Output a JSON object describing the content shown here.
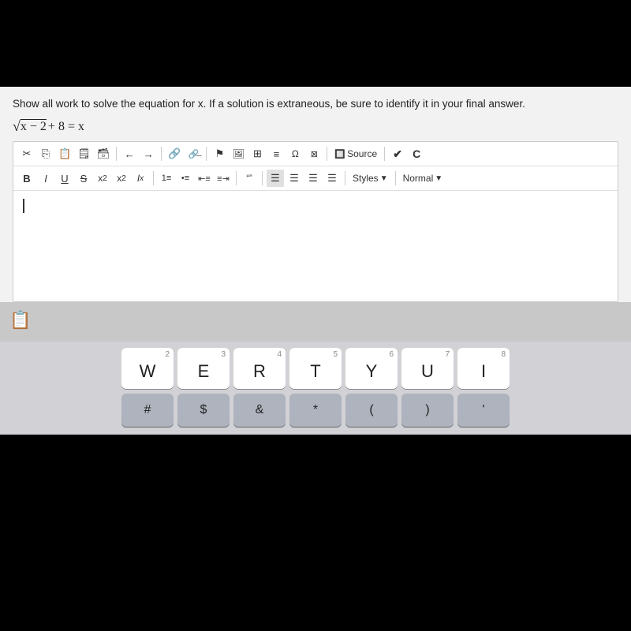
{
  "top": {
    "bg": "#000"
  },
  "question": {
    "text": "Show all work to solve the equation for x. If a solution is extraneous, be sure to identify it in your final answer.",
    "equation": "√x − 2 + 8 = x"
  },
  "toolbar": {
    "row1": {
      "buttons": [
        "✂",
        "⎘",
        "⊟",
        "⊞",
        "⊡",
        "←",
        "→",
        "🔗",
        "🔗",
        "⚑",
        "🖼",
        "⊞",
        "≡",
        "Ω",
        "⊠"
      ],
      "source_label": "Source",
      "check_label": "✔",
      "c_label": "C"
    },
    "row2": {
      "bold": "B",
      "italic": "I",
      "underline": "U",
      "strike": "S",
      "sub": "x₂",
      "sup": "x²",
      "italic_x": "Iₓ",
      "list1": "≔",
      "list2": ":≡",
      "indent1": "⊣≡",
      "indent2": "⊢≡",
      "quote": "❝❞",
      "align_left": "▤",
      "align_center": "▤",
      "align_right": "▤",
      "align_full": "▤",
      "styles_label": "Styles",
      "normal_label": "Normal"
    }
  },
  "editor": {
    "placeholder": ""
  },
  "keyboard": {
    "number_row": [
      {
        "number": "2",
        "letter": "W",
        "symbol": "#"
      },
      {
        "number": "3",
        "letter": "E",
        "symbol": "$"
      },
      {
        "number": "4",
        "letter": "R",
        "symbol": "&"
      },
      {
        "number": "5",
        "letter": "T",
        "symbol": "*"
      },
      {
        "number": "6",
        "letter": "Y",
        "symbol": "("
      },
      {
        "number": "7",
        "letter": "U",
        "symbol": ")"
      },
      {
        "number": "8",
        "letter": "I",
        "symbol": "'"
      }
    ]
  }
}
